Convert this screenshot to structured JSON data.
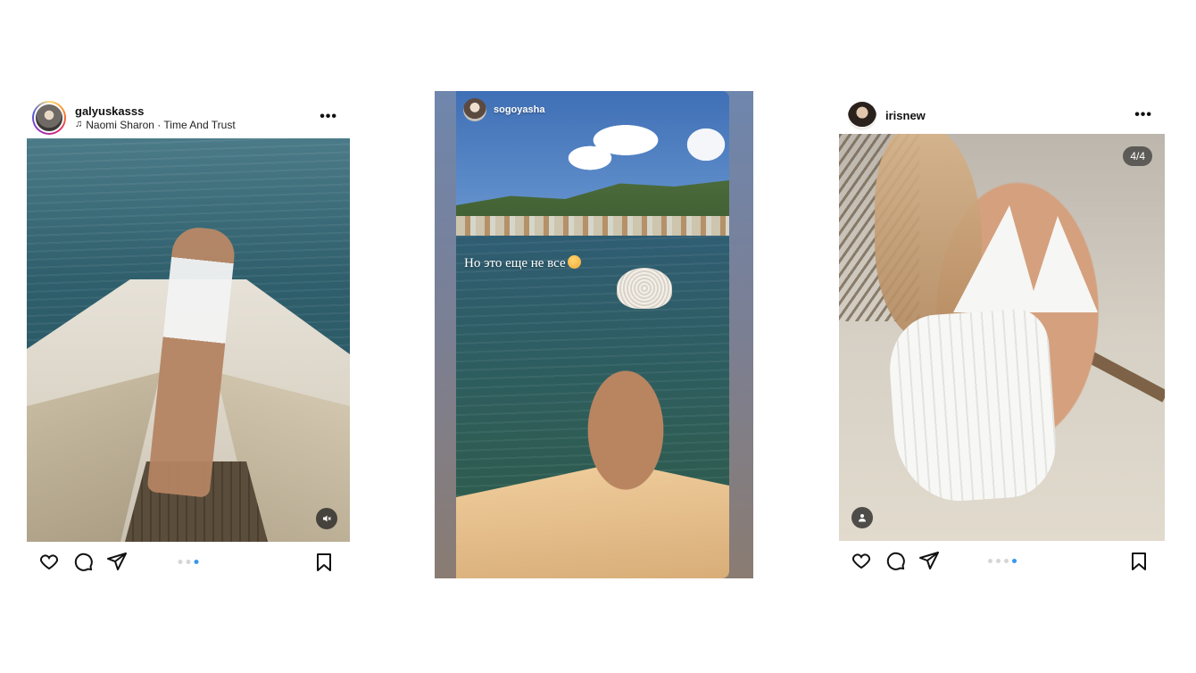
{
  "posts": {
    "left": {
      "username": "galyuskasss",
      "audio": "Naomi Sharon · Time And Trust",
      "carousel_total": 3,
      "carousel_active": 3
    },
    "story": {
      "username": "sogoyasha",
      "caption": "Но это еще не все"
    },
    "right": {
      "username": "irisnew",
      "counter": "4/4",
      "carousel_total": 4,
      "carousel_active": 4
    }
  },
  "icons": {
    "more": "more-options-icon",
    "music": "music-note-icon",
    "like": "heart-icon",
    "comment": "comment-icon",
    "share": "send-icon",
    "save": "bookmark-icon",
    "mute": "muted-speaker-icon",
    "tagged": "tagged-user-icon"
  },
  "colors": {
    "carousel_active": "#3897f0",
    "carousel_inactive": "#d6d6d6"
  }
}
